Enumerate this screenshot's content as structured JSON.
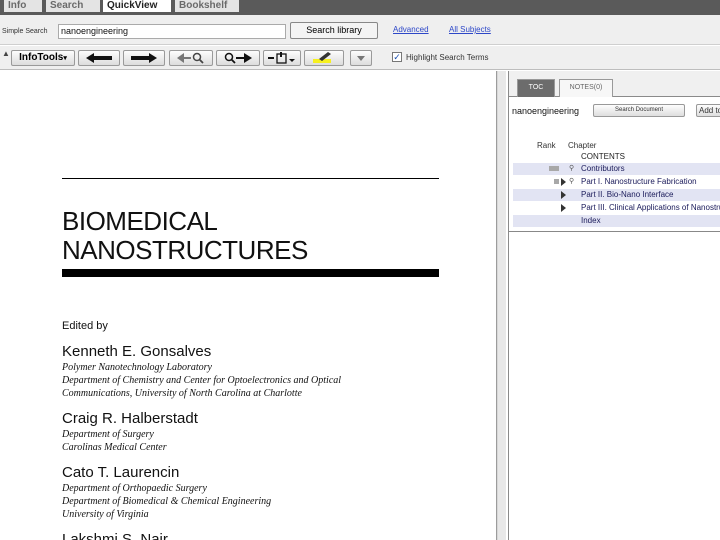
{
  "tabs": [
    {
      "label": "Info",
      "active": false
    },
    {
      "label": "Search",
      "active": false
    },
    {
      "label": "QuickView",
      "active": true
    },
    {
      "label": "Bookshelf",
      "active": false
    }
  ],
  "search": {
    "label": "Simple Search",
    "value": "nanoengineering",
    "button_label": "Search library",
    "advanced_link": "Advanced",
    "subjects_link": "All Subjects"
  },
  "toolbar": {
    "infotools_label": "InfoTools",
    "highlight_checked": true,
    "highlight_label": "Highlight Search Terms",
    "icons": [
      "back-arrow-icon",
      "forward-arrow-icon",
      "previous-hit-icon",
      "next-hit-icon",
      "bookmark-add-icon",
      "highlighter-icon",
      "more-dropdown-icon"
    ],
    "highlighter_color": "#f6f020"
  },
  "document": {
    "title_line1": "BIOMEDICAL",
    "title_line2": "NANOSTRUCTURES",
    "edited_by": "Edited by",
    "editors": [
      {
        "name": "Kenneth E. Gonsalves",
        "affiliation": [
          "Polymer Nanotechnology Laboratory",
          "Department of Chemistry and Center for Optoelectronics and Optical",
          "Communications, University of North Carolina at Charlotte"
        ]
      },
      {
        "name": "Craig R. Halberstadt",
        "affiliation": [
          "Department of Surgery",
          "Carolinas Medical Center"
        ]
      },
      {
        "name": "Cato T. Laurencin",
        "affiliation": [
          "Department of Orthopaedic Surgery",
          "Department of Biomedical & Chemical Engineering",
          "University of Virginia"
        ]
      },
      {
        "name": "Lakshmi S. Nair",
        "affiliation": []
      }
    ]
  },
  "panel": {
    "tab_toc": "TOC",
    "tab_notes": "NOTES(0)",
    "search_value": "nanoengineering",
    "search_doc_button": "Search Document",
    "add_button": "Add to",
    "col_rank": "Rank",
    "col_chapter": "Chapter",
    "rows": [
      {
        "text": "CONTENTS",
        "shaded": false,
        "rank": "none",
        "expand": false,
        "link": false
      },
      {
        "text": "Contributors",
        "shaded": true,
        "rank": "full",
        "expand": false,
        "link": true
      },
      {
        "text": "Part I. Nanostructure Fabrication",
        "shaded": false,
        "rank": "thin",
        "expand": true,
        "link": true
      },
      {
        "text": "Part II. Bio-Nano Interface",
        "shaded": true,
        "rank": "none",
        "expand": true,
        "link": false
      },
      {
        "text": "Part III. Clinical Applications of Nanostructures",
        "shaded": false,
        "rank": "none",
        "expand": true,
        "link": false
      },
      {
        "text": "Index",
        "shaded": true,
        "rank": "none",
        "expand": false,
        "link": false
      }
    ]
  }
}
